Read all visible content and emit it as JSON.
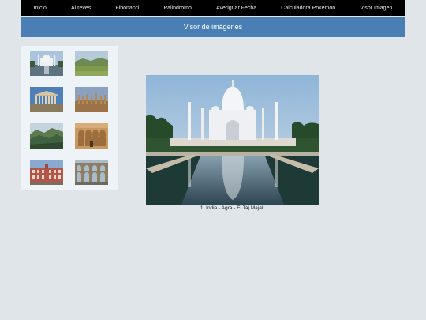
{
  "nav": {
    "items": [
      "Inicio",
      "Al reves",
      "Fibonacci",
      "Palindromo",
      "Averiguar Fecha",
      "Calculadora Pokemon",
      "Visor Imagen"
    ]
  },
  "header": {
    "title": "Visor de imágenes"
  },
  "viewer": {
    "caption": "1. India - Agra - El Taj Majal."
  },
  "colors": {
    "navbar": "#000000",
    "header": "#4a7fb5",
    "page_background": "#dfe5e9",
    "thumb_panel": "#eef3f8"
  }
}
